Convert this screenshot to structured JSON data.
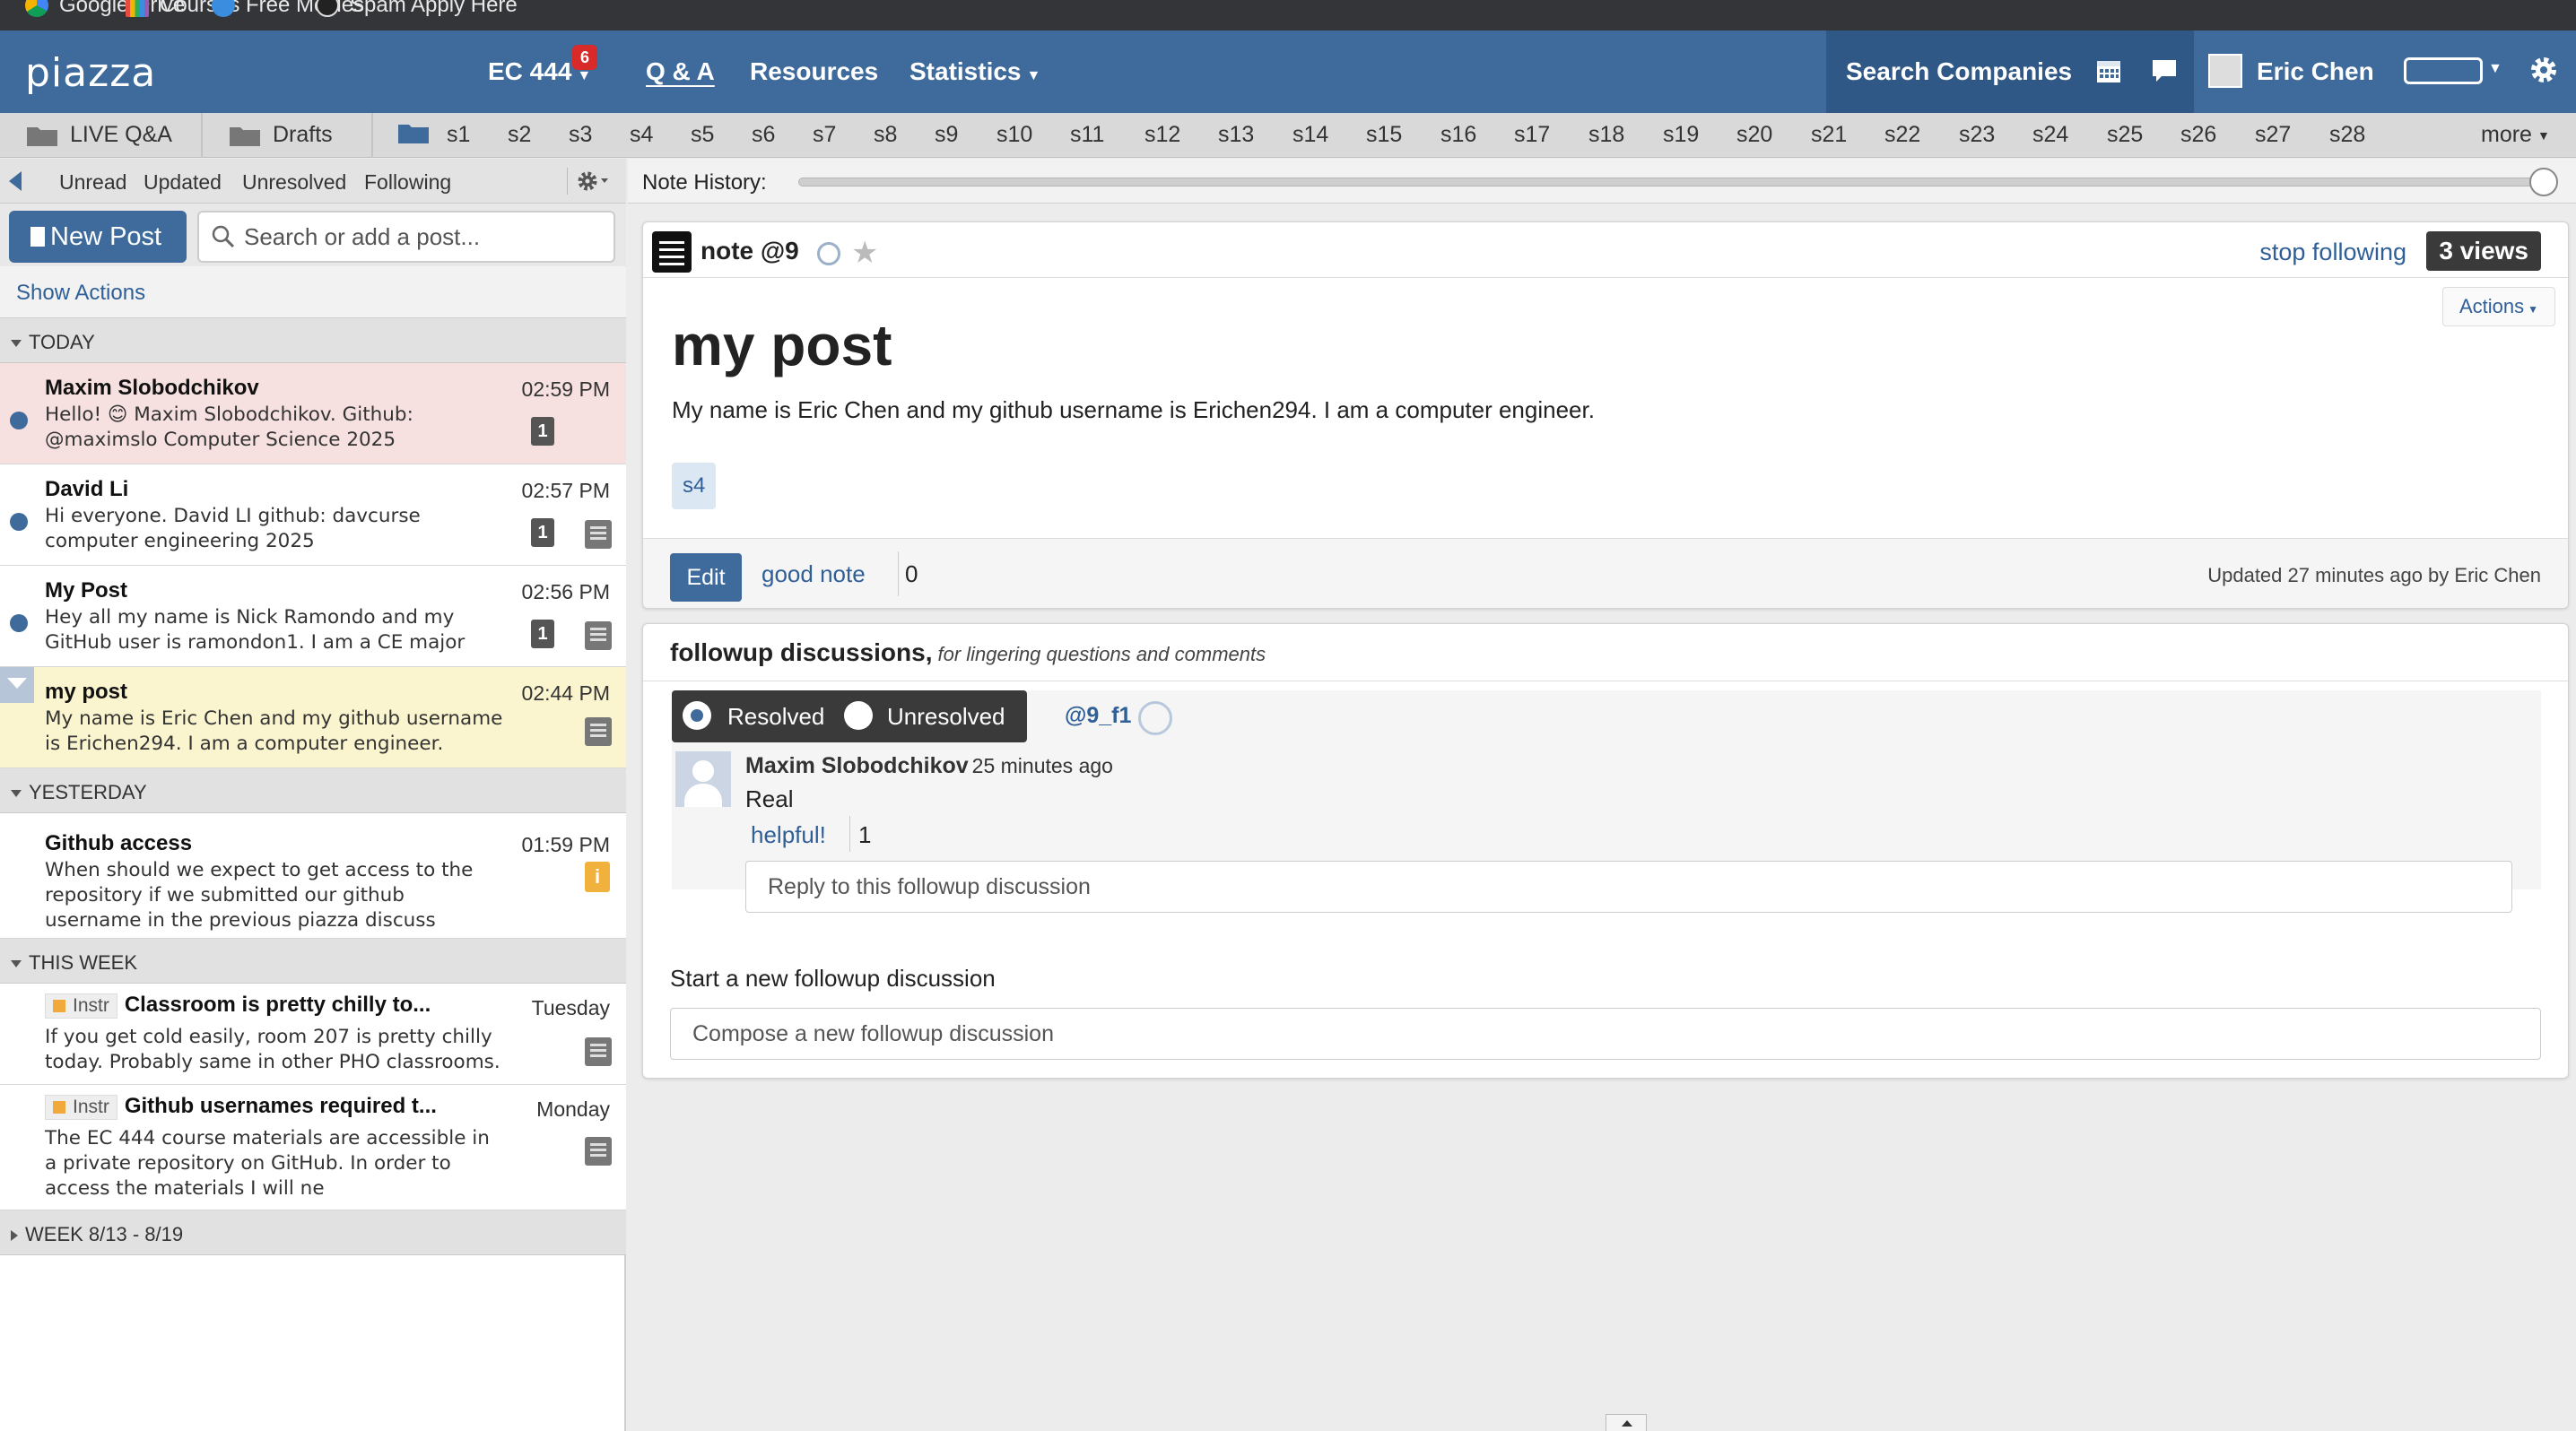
{
  "bookmarks": [
    {
      "label": "Google Drive",
      "color": "#4285f4"
    },
    {
      "label": "Courses",
      "color": "#f4b400"
    },
    {
      "label": "Free Movies",
      "color": "#3b8de0"
    },
    {
      "label": "Spam Apply Here",
      "color": "#cccccc"
    }
  ],
  "topnav": {
    "logo": "piazza",
    "course": "EC 444",
    "course_badge": "6",
    "qa": "Q & A",
    "resources": "Resources",
    "statistics": "Statistics",
    "search_companies": "Search Companies",
    "username": "Eric Chen",
    "colors": {
      "nav": "#3e6a9c",
      "nav_dark": "#2f5886",
      "badge": "#d92a2a"
    }
  },
  "folders": {
    "live_qa": "LIVE Q&A",
    "drafts": "Drafts",
    "items": [
      "s1",
      "s2",
      "s3",
      "s4",
      "s5",
      "s6",
      "s7",
      "s8",
      "s9",
      "s10",
      "s11",
      "s12",
      "s13",
      "s14",
      "s15",
      "s16",
      "s17",
      "s18",
      "s19",
      "s20",
      "s21",
      "s22",
      "s23",
      "s24",
      "s25",
      "s26",
      "s27",
      "s28"
    ],
    "more": "more"
  },
  "filters": [
    "Unread",
    "Updated",
    "Unresolved",
    "Following"
  ],
  "leftpanel": {
    "new_post": "New Post",
    "search_placeholder": "Search or add a post...",
    "show_actions": "Show Actions"
  },
  "groups": {
    "today": "TODAY",
    "yesterday": "YESTERDAY",
    "this_week": "THIS WEEK",
    "week_prev": "WEEK 8/13 - 8/19"
  },
  "posts": [
    {
      "title": "Maxim Slobodchikov",
      "snippet": "Hello! 😊 Maxim Slobodchikov. Github: @maximslo Computer Science 2025",
      "time": "02:59 PM",
      "count": "1",
      "unread": true
    },
    {
      "title": "David Li",
      "snippet": "Hi everyone. David LI github: davcurse computer engineering 2025",
      "time": "02:57 PM",
      "count": "1",
      "unread": true
    },
    {
      "title": "My Post",
      "snippet": "Hey all my name is Nick Ramondo and my GitHub user is ramondon1. I am a CE major",
      "time": "02:56 PM",
      "count": "1",
      "unread": true
    },
    {
      "title": "my post",
      "snippet": "My name is Eric Chen and my github username is Erichen294. I am a computer engineer.",
      "time": "02:44 PM",
      "selected": true
    },
    {
      "title": "Github access",
      "snippet": "When should we expect to get access to the repository if we submitted our github username in the previous piazza discuss",
      "time": "01:59 PM"
    },
    {
      "title": "Classroom is pretty chilly to...",
      "instr": "Instr",
      "snippet": "If you get cold easily, room 207 is pretty chilly today. Probably same in other PHO classrooms.",
      "time": "Tuesday"
    },
    {
      "title": "Github usernames required t...",
      "instr": "Instr",
      "snippet": "The EC 444 course materials are accessible in a private repository on GitHub. In order to access the materials I will ne",
      "time": "Monday"
    }
  ],
  "note_history_label": "Note History:",
  "note_history_position": 1.0,
  "note": {
    "label": "note @9",
    "stop_following": "stop following",
    "views": "3 views",
    "actions": "Actions",
    "title": "my post",
    "body": "My name is Eric Chen and my github username is Erichen294. I am a computer engineer.",
    "tag": "s4",
    "edit": "Edit",
    "good_note": "good note",
    "good_note_count": "0",
    "updated": "Updated 27 minutes ago by Eric Chen"
  },
  "followup": {
    "heading": "followup discussions,",
    "subheading": "for lingering questions and comments",
    "resolved": "Resolved",
    "unresolved": "Unresolved",
    "id": "@9_f1",
    "author": "Maxim Slobodchikov",
    "ago": "25 minutes ago",
    "reply": "Real",
    "helpful": "helpful!",
    "helpful_count": "1",
    "reply_placeholder": "Reply to this followup discussion",
    "start_label": "Start a new followup discussion",
    "compose_placeholder": "Compose a new followup discussion"
  }
}
